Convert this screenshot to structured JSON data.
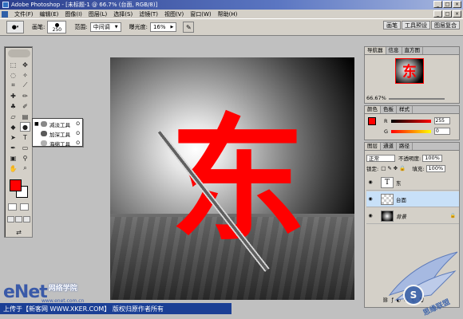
{
  "titlebar": {
    "title": "Adobe Photoshop - [未标题-1 @ 66.7% (台面, RGB/8)]"
  },
  "menu": [
    "文件(F)",
    "编辑(E)",
    "图像(I)",
    "图层(L)",
    "选择(S)",
    "滤镜(T)",
    "视图(V)",
    "窗口(W)",
    "帮助(H)"
  ],
  "options": {
    "brush_label": "画笔:",
    "brush_size": "250",
    "range_label": "范围:",
    "range_value": "中间调",
    "exposure_label": "曝光度:",
    "exposure_value": "16%"
  },
  "palette_well": [
    "画笔",
    "工具预设",
    "图层复合"
  ],
  "flyout": [
    {
      "label": "减淡工具",
      "key": "O",
      "selected": true
    },
    {
      "label": "加深工具",
      "key": "O",
      "selected": false
    },
    {
      "label": "海绵工具",
      "key": "O",
      "selected": false
    }
  ],
  "canvas": {
    "glyph": "东"
  },
  "navigator": {
    "tabs": [
      "导航器",
      "信息",
      "直方图"
    ],
    "zoom": "66.67%",
    "thumb_glyph": "东"
  },
  "color": {
    "tabs": [
      "颜色",
      "色板",
      "样式"
    ],
    "rows": [
      {
        "channel": "R",
        "value": "255"
      },
      {
        "channel": "G",
        "value": "0"
      }
    ],
    "foreground": "#ff0000"
  },
  "layers": {
    "tabs": [
      "图层",
      "通道",
      "路径"
    ],
    "blend_mode": "正常",
    "opacity_label": "不透明度:",
    "opacity_value": "100%",
    "lock_label": "锁定:",
    "fill_label": "填充:",
    "fill_value": "100%",
    "items": [
      {
        "name": "东",
        "thumb": "T"
      },
      {
        "name": "台面",
        "thumb": ""
      },
      {
        "name": "背景",
        "thumb": ""
      }
    ]
  },
  "watermark": {
    "logo": "eNet",
    "chinese": "网络学院",
    "domain": "www.enet.com.cn",
    "bottom_text": "上传于【新客网 WWW.XKER.COM】 版权归原作者所有",
    "badge_text": "思缘联盟"
  }
}
